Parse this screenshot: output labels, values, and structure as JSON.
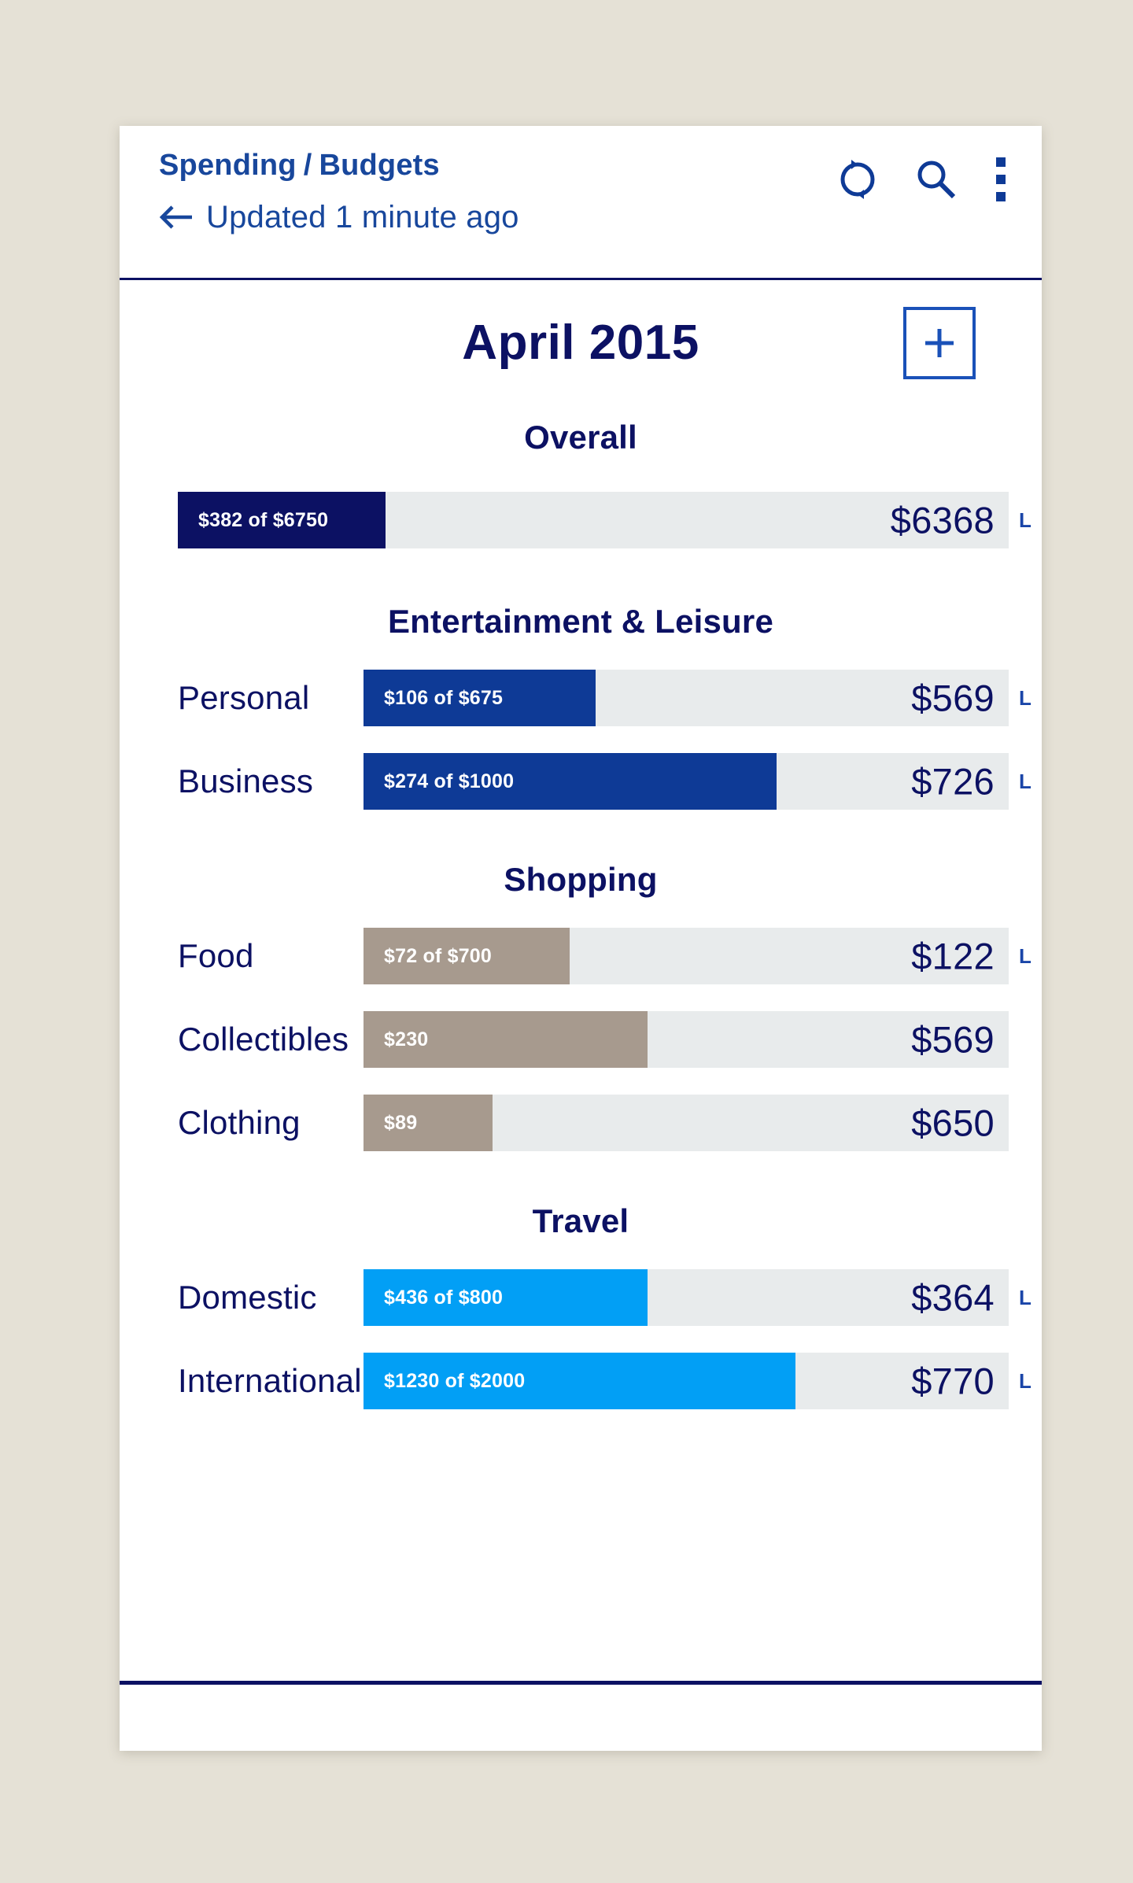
{
  "theme": {
    "page_bg": "#e5e1d6",
    "card_bg": "#ffffff",
    "navy": "#0c1163",
    "link_blue": "#18479c",
    "track": "#e8ebec",
    "tan": "#a79a8e",
    "cyan": "#029ff5",
    "mid_blue": "#0e3a96"
  },
  "header": {
    "breadcrumb_parent": "Spending",
    "breadcrumb_sep": "/",
    "breadcrumb_current": "Budgets",
    "updated_text": "Updated 1 minute ago",
    "back_icon": "back-arrow-icon",
    "icons": [
      {
        "name": "refresh-icon",
        "label": "Refresh"
      },
      {
        "name": "search-icon",
        "label": "Search"
      },
      {
        "name": "more-menu-icon",
        "label": "More options"
      }
    ]
  },
  "page": {
    "title": "April 2015",
    "add_button_label": "+"
  },
  "chart_data": {
    "type": "bar",
    "title": "April 2015",
    "orientation": "horizontal",
    "note": "Budget progress bars: filled portion = spent, right-aligned value = remaining",
    "sections": [
      {
        "heading": "Overall",
        "bar_color": "#0c1163",
        "rows": [
          {
            "label": "",
            "show_label": false,
            "fill_text": "$382 of $6750",
            "spent": 382,
            "budget": 6750,
            "remaining_text": "$6368",
            "remaining": 6368,
            "fill_pct": 25,
            "marker": "L"
          }
        ]
      },
      {
        "heading": "Entertainment & Leisure",
        "bar_color": "#0e3a96",
        "rows": [
          {
            "label": "Personal",
            "show_label": true,
            "fill_text": "$106 of $675",
            "spent": 106,
            "budget": 675,
            "remaining_text": "$569",
            "remaining": 569,
            "fill_pct": 36,
            "marker": "L"
          },
          {
            "label": "Business",
            "show_label": true,
            "fill_text": "$274 of $1000",
            "spent": 274,
            "budget": 1000,
            "remaining_text": "$726",
            "remaining": 726,
            "fill_pct": 64,
            "marker": "L"
          }
        ]
      },
      {
        "heading": "Shopping",
        "bar_color": "#a79a8e",
        "rows": [
          {
            "label": "Food",
            "show_label": true,
            "fill_text": "$72 of $700",
            "spent": 72,
            "budget": 700,
            "remaining_text": "$122",
            "remaining": 122,
            "fill_pct": 32,
            "marker": "L"
          },
          {
            "label": "Collectibles",
            "show_label": true,
            "fill_text": "$230",
            "spent": 230,
            "budget": null,
            "remaining_text": "$569",
            "remaining": 569,
            "fill_pct": 44,
            "marker": ""
          },
          {
            "label": "Clothing",
            "show_label": true,
            "fill_text": "$89",
            "spent": 89,
            "budget": null,
            "remaining_text": "$650",
            "remaining": 650,
            "fill_pct": 20,
            "marker": ""
          }
        ]
      },
      {
        "heading": "Travel",
        "bar_color": "#029ff5",
        "rows": [
          {
            "label": "Domestic",
            "show_label": true,
            "fill_text": "$436 of $800",
            "spent": 436,
            "budget": 800,
            "remaining_text": "$364",
            "remaining": 364,
            "fill_pct": 44,
            "marker": "L"
          },
          {
            "label": "International",
            "show_label": true,
            "fill_text": "$1230 of $2000",
            "spent": 1230,
            "budget": 2000,
            "remaining_text": "$770",
            "remaining": 770,
            "fill_pct": 67,
            "marker": "L"
          }
        ]
      }
    ]
  }
}
